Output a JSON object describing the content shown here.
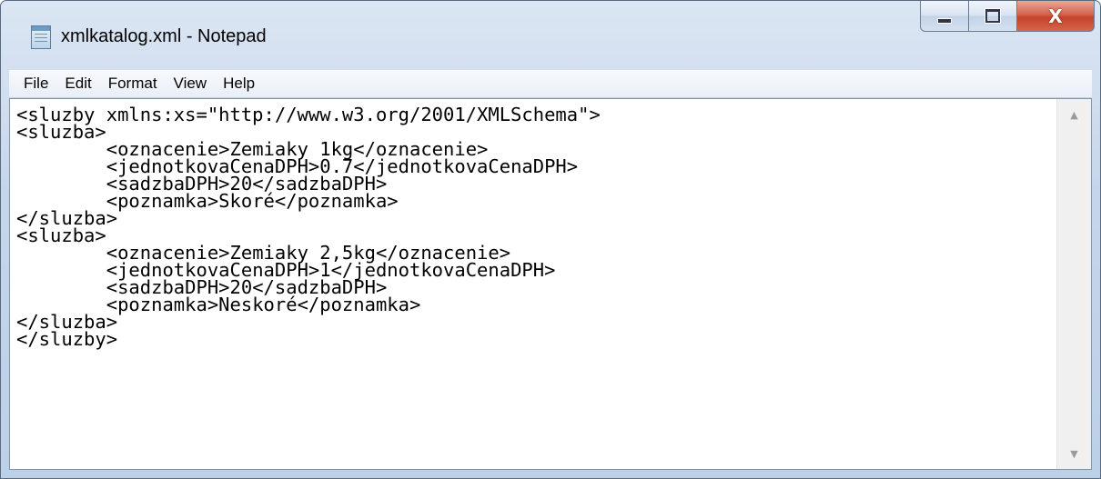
{
  "window": {
    "title": "xmlkatalog.xml - Notepad",
    "icon": "notepad-icon",
    "controls": {
      "minimize_icon": "minimize-icon",
      "maximize_icon": "maximize-icon",
      "close_label": "X"
    }
  },
  "menu": {
    "items": [
      {
        "label": "File"
      },
      {
        "label": "Edit"
      },
      {
        "label": "Format"
      },
      {
        "label": "View"
      },
      {
        "label": "Help"
      }
    ]
  },
  "editor": {
    "content": "<sluzby xmlns:xs=\"http://www.w3.org/2001/XMLSchema\">\n<sluzba>\n\t<oznacenie>Zemiaky 1kg</oznacenie>\n\t<jednotkovaCenaDPH>0.7</jednotkovaCenaDPH>\n\t<sadzbaDPH>20</sadzbaDPH>\n\t<poznamka>Skoré</poznamka>\n</sluzba>\n<sluzba>\n\t<oznacenie>Zemiaky 2,5kg</oznacenie>\n\t<jednotkovaCenaDPH>1</jednotkovaCenaDPH>\n\t<sadzbaDPH>20</sadzbaDPH>\n\t<poznamka>Neskoré</poznamka>\n</sluzba>\n</sluzby>"
  },
  "scrollbar": {
    "up_arrow": "▲",
    "down_arrow": "▼"
  },
  "colors": {
    "titlebar": "#c6d6ea",
    "close_button": "#c3432b",
    "editor_background": "#ffffff"
  }
}
